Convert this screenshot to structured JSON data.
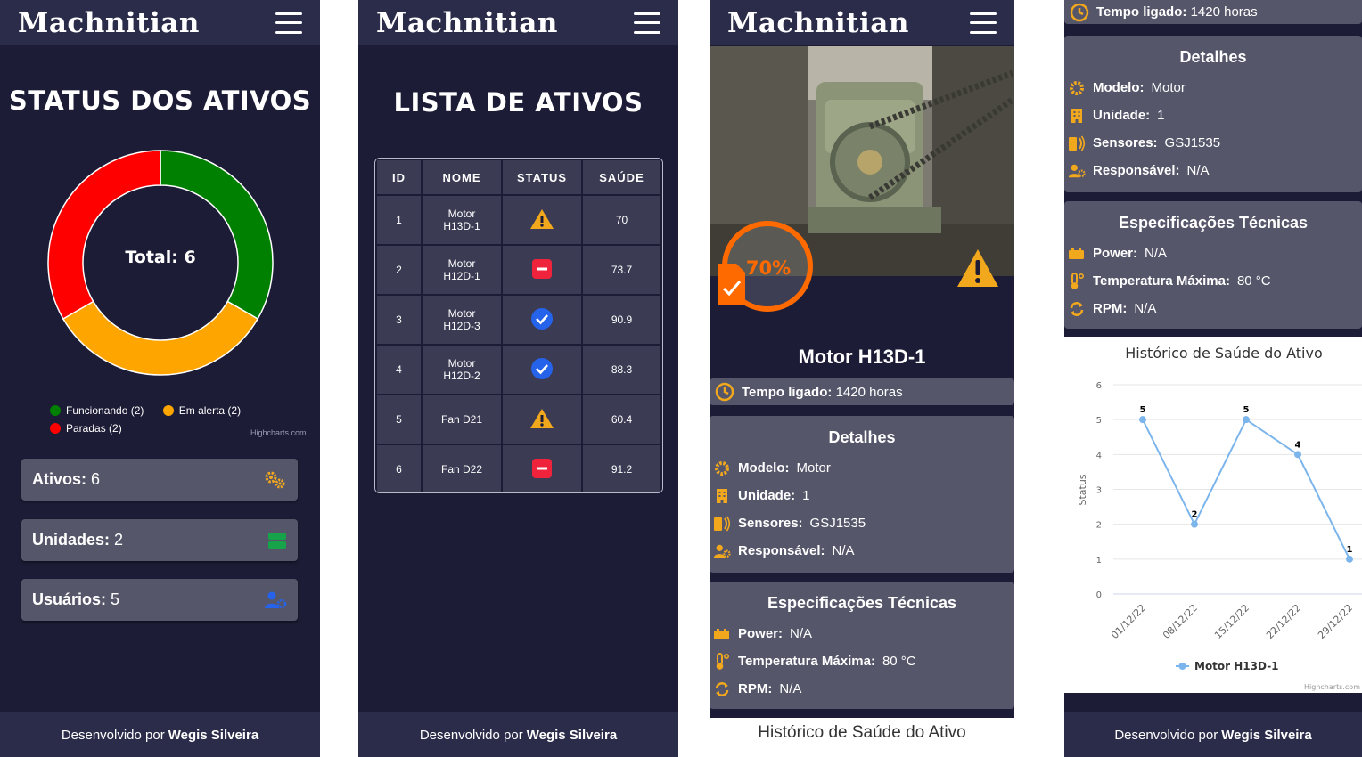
{
  "app": {
    "brand": "Machnitian"
  },
  "footer": {
    "prefix": "Desenvolvido por",
    "author": "Wegis Silveira"
  },
  "status": {
    "title": "STATUS DOS ATIVOS",
    "total_label": "Total: 6",
    "legend": [
      {
        "label": "Funcionando (2)",
        "color": "#008000"
      },
      {
        "label": "Em alerta (2)",
        "color": "#ffa500"
      },
      {
        "label": "Paradas (2)",
        "color": "#ff0000"
      }
    ],
    "credit": "Highcharts.com",
    "cards": [
      {
        "label": "Ativos:",
        "value": "6",
        "icon": "gears-icon"
      },
      {
        "label": "Unidades:",
        "value": "2",
        "icon": "server-icon"
      },
      {
        "label": "Usuários:",
        "value": "5",
        "icon": "users-cog-icon"
      }
    ]
  },
  "chart_data": [
    {
      "type": "pie",
      "title": "Total: 6",
      "categories": [
        "Funcionando (2)",
        "Em alerta (2)",
        "Paradas (2)"
      ],
      "values": [
        2,
        2,
        2
      ],
      "colors": [
        "#008000",
        "#ffa500",
        "#ff0000"
      ],
      "legend": "bottom"
    },
    {
      "type": "line",
      "title": "Histórico de Saúde do Ativo",
      "ylabel": "Status",
      "x": [
        "01/12/22",
        "08/12/22",
        "15/12/22",
        "22/12/22",
        "29/12/22"
      ],
      "series": [
        {
          "name": "Motor H13D-1",
          "values": [
            5,
            2,
            5,
            4,
            1
          ]
        }
      ],
      "ylim": [
        0,
        6
      ],
      "yticks": [
        0,
        1,
        2,
        3,
        4,
        5,
        6
      ],
      "grid": true,
      "legend": "bottom",
      "credit": "Highcharts.com"
    }
  ],
  "list": {
    "title": "LISTA DE ATIVOS",
    "headers": [
      "ID",
      "NOME",
      "STATUS",
      "SAÚDE"
    ],
    "rows": [
      {
        "id": "1",
        "name": "Motor H13D-1",
        "status": "alert",
        "health": "70"
      },
      {
        "id": "2",
        "name": "Motor H12D-1",
        "status": "stopped",
        "health": "73.7"
      },
      {
        "id": "3",
        "name": "Motor H12D-3",
        "status": "ok",
        "health": "90.9"
      },
      {
        "id": "4",
        "name": "Motor H12D-2",
        "status": "ok",
        "health": "88.3"
      },
      {
        "id": "5",
        "name": "Fan D21",
        "status": "alert",
        "health": "60.4"
      },
      {
        "id": "6",
        "name": "Fan D22",
        "status": "stopped",
        "health": "91.2"
      }
    ]
  },
  "asset": {
    "name": "Motor H13D-1",
    "health": "70%",
    "uptime_label": "Tempo ligado:",
    "uptime_value": "1420 horas",
    "details_title": "Detalhes",
    "details": [
      {
        "label": "Modelo:",
        "value": "Motor",
        "icon": "gear-icon"
      },
      {
        "label": "Unidade:",
        "value": "1",
        "icon": "building-icon"
      },
      {
        "label": "Sensores:",
        "value": "GSJ1535",
        "icon": "sensor-icon"
      },
      {
        "label": "Responsável:",
        "value": "N/A",
        "icon": "user-cog-icon"
      }
    ],
    "specs_title": "Especificações Técnicas",
    "specs": [
      {
        "label": "Power:",
        "value": "N/A",
        "icon": "battery-icon"
      },
      {
        "label": "Temperatura Máxima:",
        "value": "80 °C",
        "icon": "thermometer-icon"
      },
      {
        "label": "RPM:",
        "value": "N/A",
        "icon": "rotate-icon"
      }
    ],
    "history_title": "Histórico de Saúde do Ativo"
  },
  "colors": {
    "bg": "#1c1c36",
    "bar": "#2b2b4a",
    "card": "#55566a",
    "accent": "#f2a81d",
    "ok": "#2563eb",
    "stopped": "#ef233c",
    "line": "#7cb5ec"
  }
}
